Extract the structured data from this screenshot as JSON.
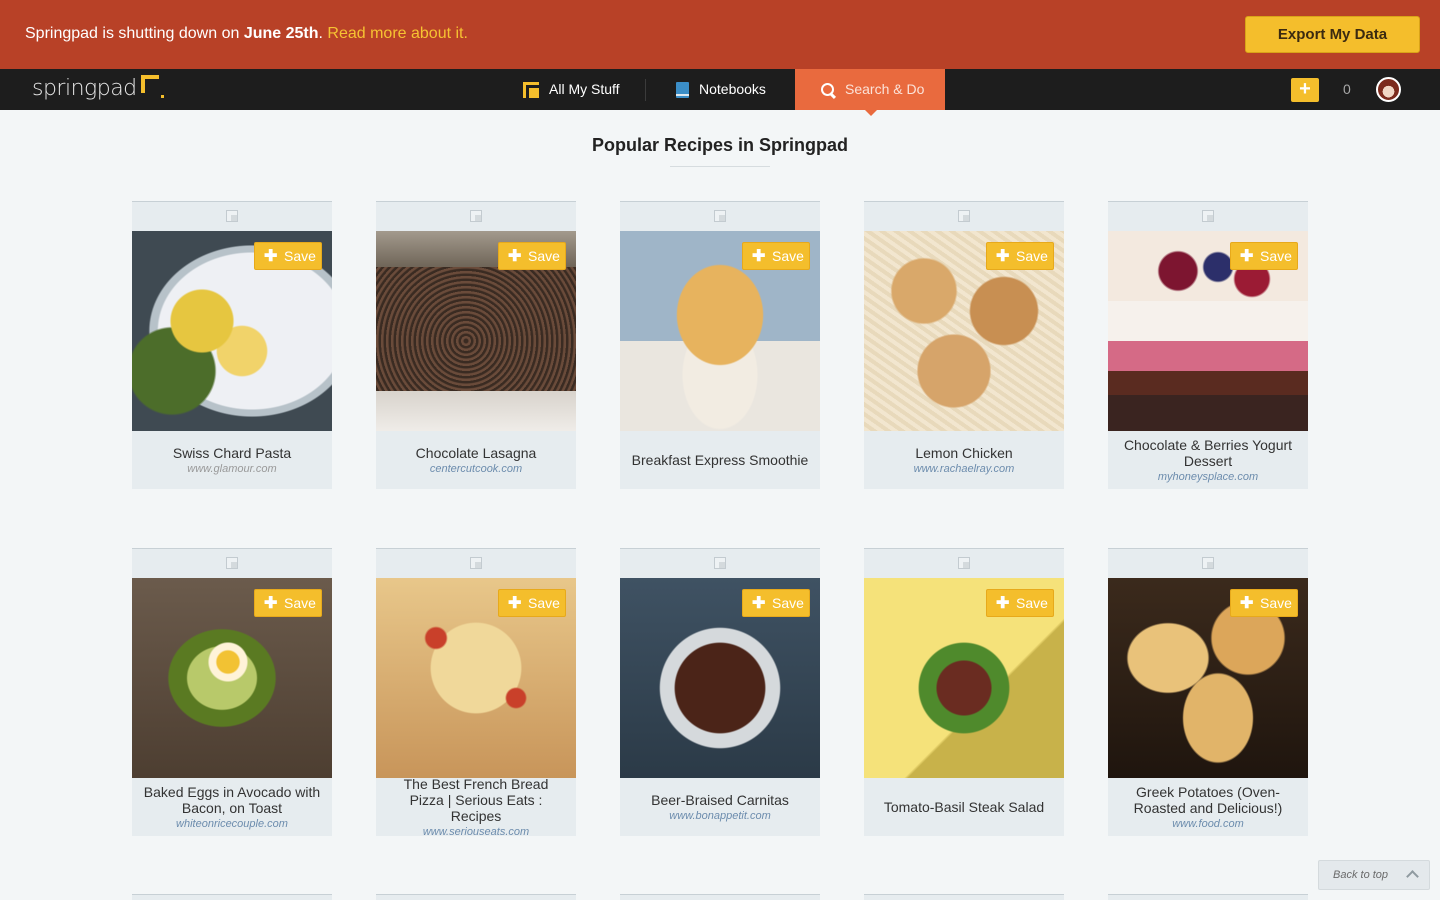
{
  "banner": {
    "message_plain": "Springpad is shutting down on ",
    "message_date": "June 25th",
    "message_period": ".",
    "link_text": "Read more about it.",
    "export_label": "Export My Data"
  },
  "nav": {
    "logo_text": "springpad",
    "all_my_stuff": "All My Stuff",
    "notebooks": "Notebooks",
    "search_do": "Search & Do",
    "add_label": "+",
    "count": "0"
  },
  "page": {
    "title": "Popular Recipes in Springpad"
  },
  "save_label": "Save",
  "cards": [
    {
      "title": "Swiss Chard Pasta",
      "source": "www.glamour.com"
    },
    {
      "title": "Chocolate Lasagna",
      "source": "centercutcook.com"
    },
    {
      "title": "Breakfast Express Smoothie",
      "source": ""
    },
    {
      "title": "Lemon Chicken",
      "source": "www.rachaelray.com"
    },
    {
      "title": "Chocolate & Berries Yogurt Dessert",
      "source": "myhoneysplace.com"
    },
    {
      "title": "Baked Eggs in Avocado with Bacon, on Toast",
      "source": "whiteonricecouple.com"
    },
    {
      "title": "The Best French Bread Pizza | Serious Eats : Recipes",
      "source": "www.seriouseats.com"
    },
    {
      "title": "Beer-Braised Carnitas",
      "source": "www.bonappetit.com"
    },
    {
      "title": "Tomato-Basil Steak Salad",
      "source": ""
    },
    {
      "title": "Greek Potatoes (Oven-Roasted and Delicious!)",
      "source": "www.food.com"
    }
  ],
  "back_to_top": "Back to top",
  "colors": {
    "banner": "#b84127",
    "accent_yellow": "#f4be2c",
    "search_orange": "#e96a3e",
    "nav_bg": "#1d1d1d"
  }
}
